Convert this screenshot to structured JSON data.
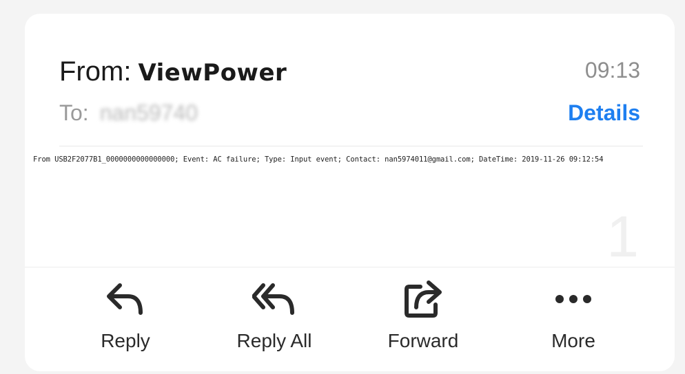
{
  "header": {
    "from_label": "From:",
    "from_name": "ViewPower",
    "time": "09:13",
    "to_label": "To:",
    "to_value": "nan59740",
    "details_label": "Details"
  },
  "message": {
    "body": "From USB2F2077B1_0000000000000000;  Event: AC failure;  Type: Input event;  Contact: nan5974011@gmail.com;  DateTime: 2019-11-26 09:12:54"
  },
  "page_number": "1",
  "actions": [
    {
      "label": "Reply",
      "icon": "reply-icon"
    },
    {
      "label": "Reply All",
      "icon": "reply-all-icon"
    },
    {
      "label": "Forward",
      "icon": "forward-icon"
    },
    {
      "label": "More",
      "icon": "more-icon"
    }
  ],
  "colors": {
    "accent": "#1e7ff0",
    "text": "#1a1a1a",
    "muted": "#8e8e8e"
  }
}
